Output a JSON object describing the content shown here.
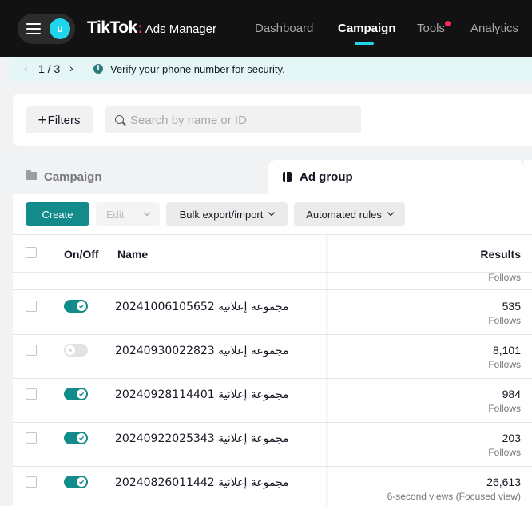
{
  "nav": {
    "avatar_letter": "u",
    "brand": "TikTok",
    "brand_colon": ":",
    "product": "Ads Manager",
    "items": [
      {
        "label": "Dashboard",
        "active": false
      },
      {
        "label": "Campaign",
        "active": true
      },
      {
        "label": "Tools",
        "active": false,
        "has_dot": true
      },
      {
        "label": "Analytics",
        "active": false
      }
    ]
  },
  "notice": {
    "pager": "1 / 3",
    "prev_icon": "chevron-left-icon",
    "next_icon": "chevron-right-icon",
    "text": "Verify your phone number for security."
  },
  "filters": {
    "filters_label": "Filters",
    "search_placeholder": "Search by name or ID"
  },
  "tabs": [
    {
      "label": "Campaign",
      "icon": "folder-icon",
      "active": false
    },
    {
      "label": "Ad group",
      "icon": "ad-group-icon",
      "active": true
    }
  ],
  "toolbar": {
    "create": "Create",
    "edit": "Edit",
    "bulk": "Bulk export/import",
    "rules": "Automated rules"
  },
  "table": {
    "columns": {
      "onoff": "On/Off",
      "name": "Name",
      "results": "Results"
    },
    "partial_row_label": "Follows",
    "rows": [
      {
        "name": "مجموعة إعلانية 20241006105652",
        "on": true,
        "value": "535",
        "label": "Follows"
      },
      {
        "name": "مجموعة إعلانية 20240930022823",
        "on": false,
        "value": "8,101",
        "label": "Follows"
      },
      {
        "name": "مجموعة إعلانية 20240928114401",
        "on": true,
        "value": "984",
        "label": "Follows"
      },
      {
        "name": "مجموعة إعلانية 20240922025343",
        "on": true,
        "value": "203",
        "label": "Follows"
      },
      {
        "name": "مجموعة إعلانية 20240826011442",
        "on": true,
        "value": "26,613",
        "label": "6-second views (Focused view)"
      }
    ]
  },
  "colors": {
    "accent": "#138b8a",
    "nav_bg": "#121212",
    "brand_colon": "#fe2c55",
    "notice_bg": "#e4f7f6"
  }
}
